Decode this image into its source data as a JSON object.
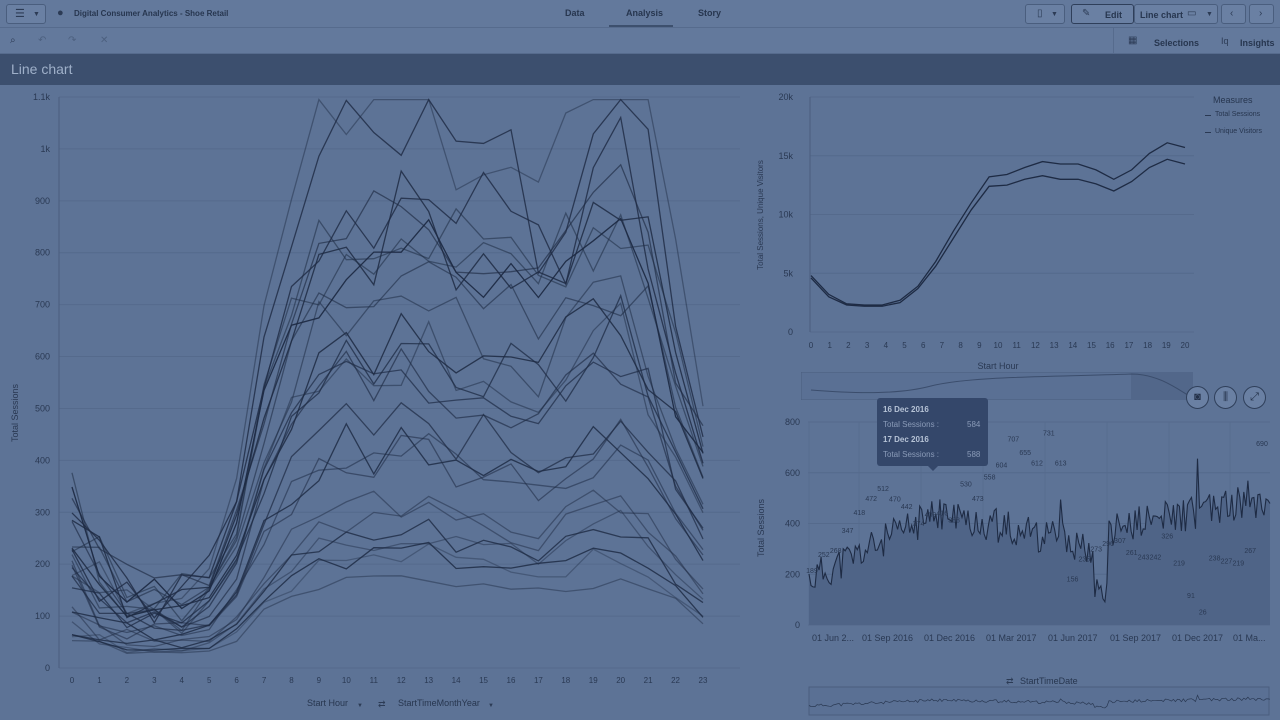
{
  "app": {
    "title": "Digital Consumer Analytics - Shoe Retail",
    "tabs": [
      {
        "label": "Data",
        "active": false
      },
      {
        "label": "Analysis",
        "active": true
      },
      {
        "label": "Story",
        "active": false
      }
    ],
    "edit_label": "Edit",
    "sheet_selector_label": "Line chart",
    "selections_label": "Selections",
    "insights_label": "Insights"
  },
  "sheet": {
    "title": "Line chart"
  },
  "main_chart": {
    "type": "line",
    "ylabel": "Total Sessions",
    "x_dim_label": "Start Hour",
    "series_dim_label": "StartTimeMonthYear",
    "y_ticks": [
      "0",
      "100",
      "200",
      "300",
      "400",
      "500",
      "600",
      "700",
      "800",
      "900",
      "1k",
      "1.1k"
    ],
    "x": [
      0,
      1,
      2,
      3,
      4,
      5,
      6,
      7,
      8,
      9,
      10,
      11,
      12,
      13,
      14,
      15,
      16,
      17,
      18,
      19,
      20,
      21,
      22,
      23
    ],
    "ylim": [
      0,
      1100
    ]
  },
  "top_right_chart": {
    "type": "line",
    "ylabel": "Total Sessions, Unique Visitors",
    "xlabel": "Start Hour",
    "y_ticks": [
      "0",
      "5k",
      "10k",
      "15k",
      "20k"
    ],
    "x": [
      0,
      1,
      2,
      3,
      4,
      5,
      6,
      7,
      8,
      9,
      10,
      11,
      12,
      13,
      14,
      15,
      16,
      17,
      18,
      19,
      20
    ],
    "legend_title": "Measures",
    "series": [
      {
        "name": "Total Sessions",
        "values": [
          4800,
          3200,
          2400,
          2300,
          2300,
          2700,
          3900,
          6000,
          8600,
          11000,
          13200,
          13400,
          14000,
          14500,
          14300,
          14300,
          13800,
          13000,
          13800,
          15200,
          16100,
          15700
        ]
      },
      {
        "name": "Unique Visitors",
        "values": [
          4600,
          3000,
          2300,
          2200,
          2200,
          2500,
          3700,
          5600,
          8000,
          10400,
          12400,
          12500,
          13000,
          13300,
          13000,
          13000,
          12600,
          12000,
          12800,
          14000,
          14700,
          14300
        ]
      }
    ],
    "ylim": [
      0,
      20000
    ]
  },
  "bottom_right_chart": {
    "type": "line",
    "ylabel": "Total Sessions",
    "dim_label": "StartTimeDate",
    "y_ticks": [
      "0",
      "200",
      "400",
      "600",
      "800"
    ],
    "x_ticks": [
      "01 Jun 2...",
      "01 Sep 2016",
      "01 Dec 2016",
      "01 Mar 2017",
      "01 Jun 2017",
      "01 Sep 2017",
      "01 Dec 2017",
      "01 Ma..."
    ],
    "data_labels": [
      "189",
      "252",
      "268",
      "347",
      "418",
      "472",
      "512",
      "470",
      "442",
      "374",
      "409",
      "416",
      "388",
      "530",
      "473",
      "558",
      "604",
      "707",
      "655",
      "612",
      "731",
      "613",
      "156",
      "235",
      "273",
      "296",
      "307",
      "261",
      "243",
      "242",
      "326",
      "219",
      "91",
      "26",
      "238",
      "227",
      "219",
      "267",
      "690"
    ],
    "ylim": [
      0,
      800
    ],
    "tooltip": {
      "date1": "16 Dec 2016",
      "label1": "Total Sessions :",
      "value1": "584",
      "date2": "17 Dec 2016",
      "label2": "Total Sessions :",
      "value2": "588"
    }
  }
}
